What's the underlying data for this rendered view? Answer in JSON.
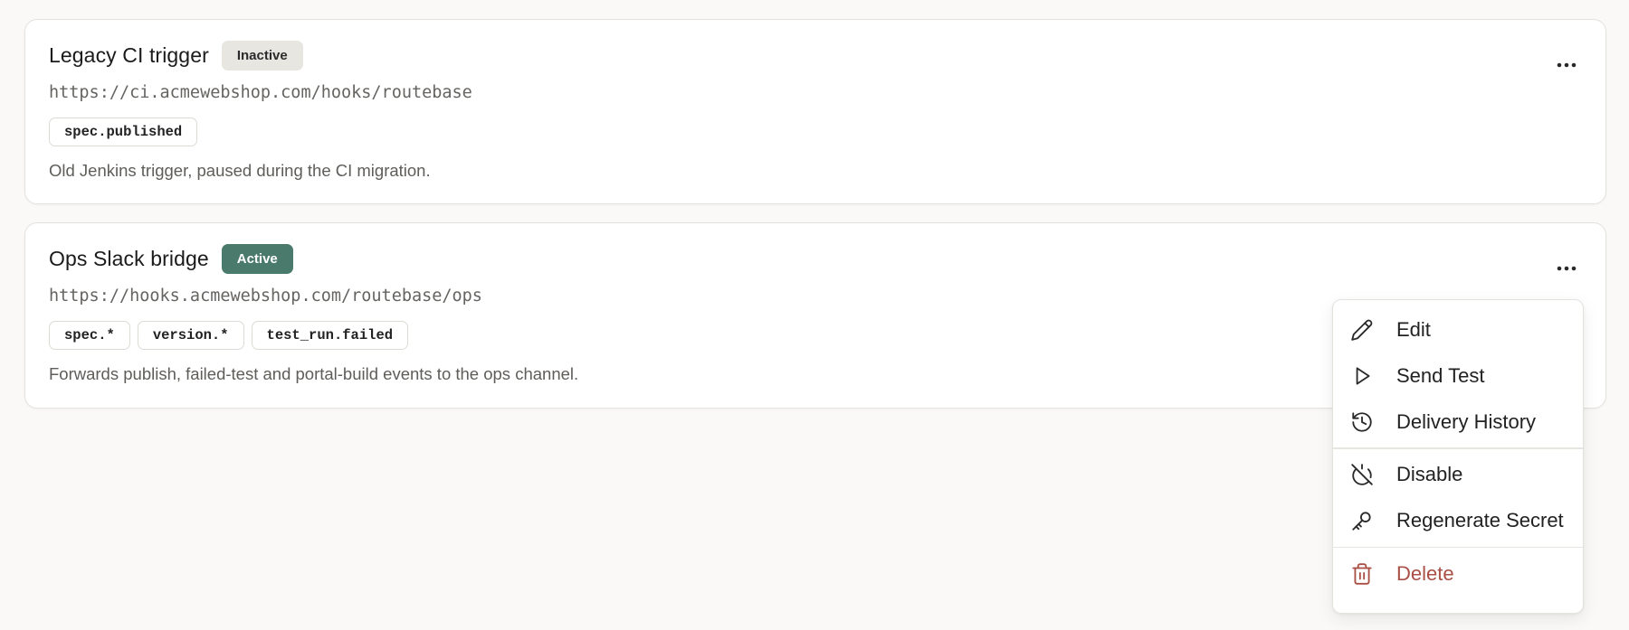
{
  "webhooks": [
    {
      "name": "Legacy CI trigger",
      "status": "Inactive",
      "url": "https://ci.acmewebshop.com/hooks/routebase",
      "events": [
        "spec.published"
      ],
      "description": "Old Jenkins trigger, paused during the CI migration."
    },
    {
      "name": "Ops Slack bridge",
      "status": "Active",
      "url": "https://hooks.acmewebshop.com/routebase/ops",
      "events": [
        "spec.*",
        "version.*",
        "test_run.failed"
      ],
      "description": "Forwards publish, failed-test and portal-build events to the ops channel."
    }
  ],
  "menu": {
    "edit": "Edit",
    "send_test": "Send Test",
    "delivery_history": "Delivery History",
    "disable": "Disable",
    "regenerate_secret": "Regenerate Secret",
    "delete": "Delete"
  },
  "colors": {
    "active_badge": "#4a7a6b",
    "inactive_badge": "#e8e6e1",
    "danger": "#a94f45"
  },
  "icons": {
    "more": "more-horizontal-icon",
    "edit": "pencil-icon",
    "send_test": "play-icon",
    "delivery_history": "history-icon",
    "disable": "power-off-icon",
    "regenerate_secret": "key-icon",
    "delete": "trash-icon"
  }
}
